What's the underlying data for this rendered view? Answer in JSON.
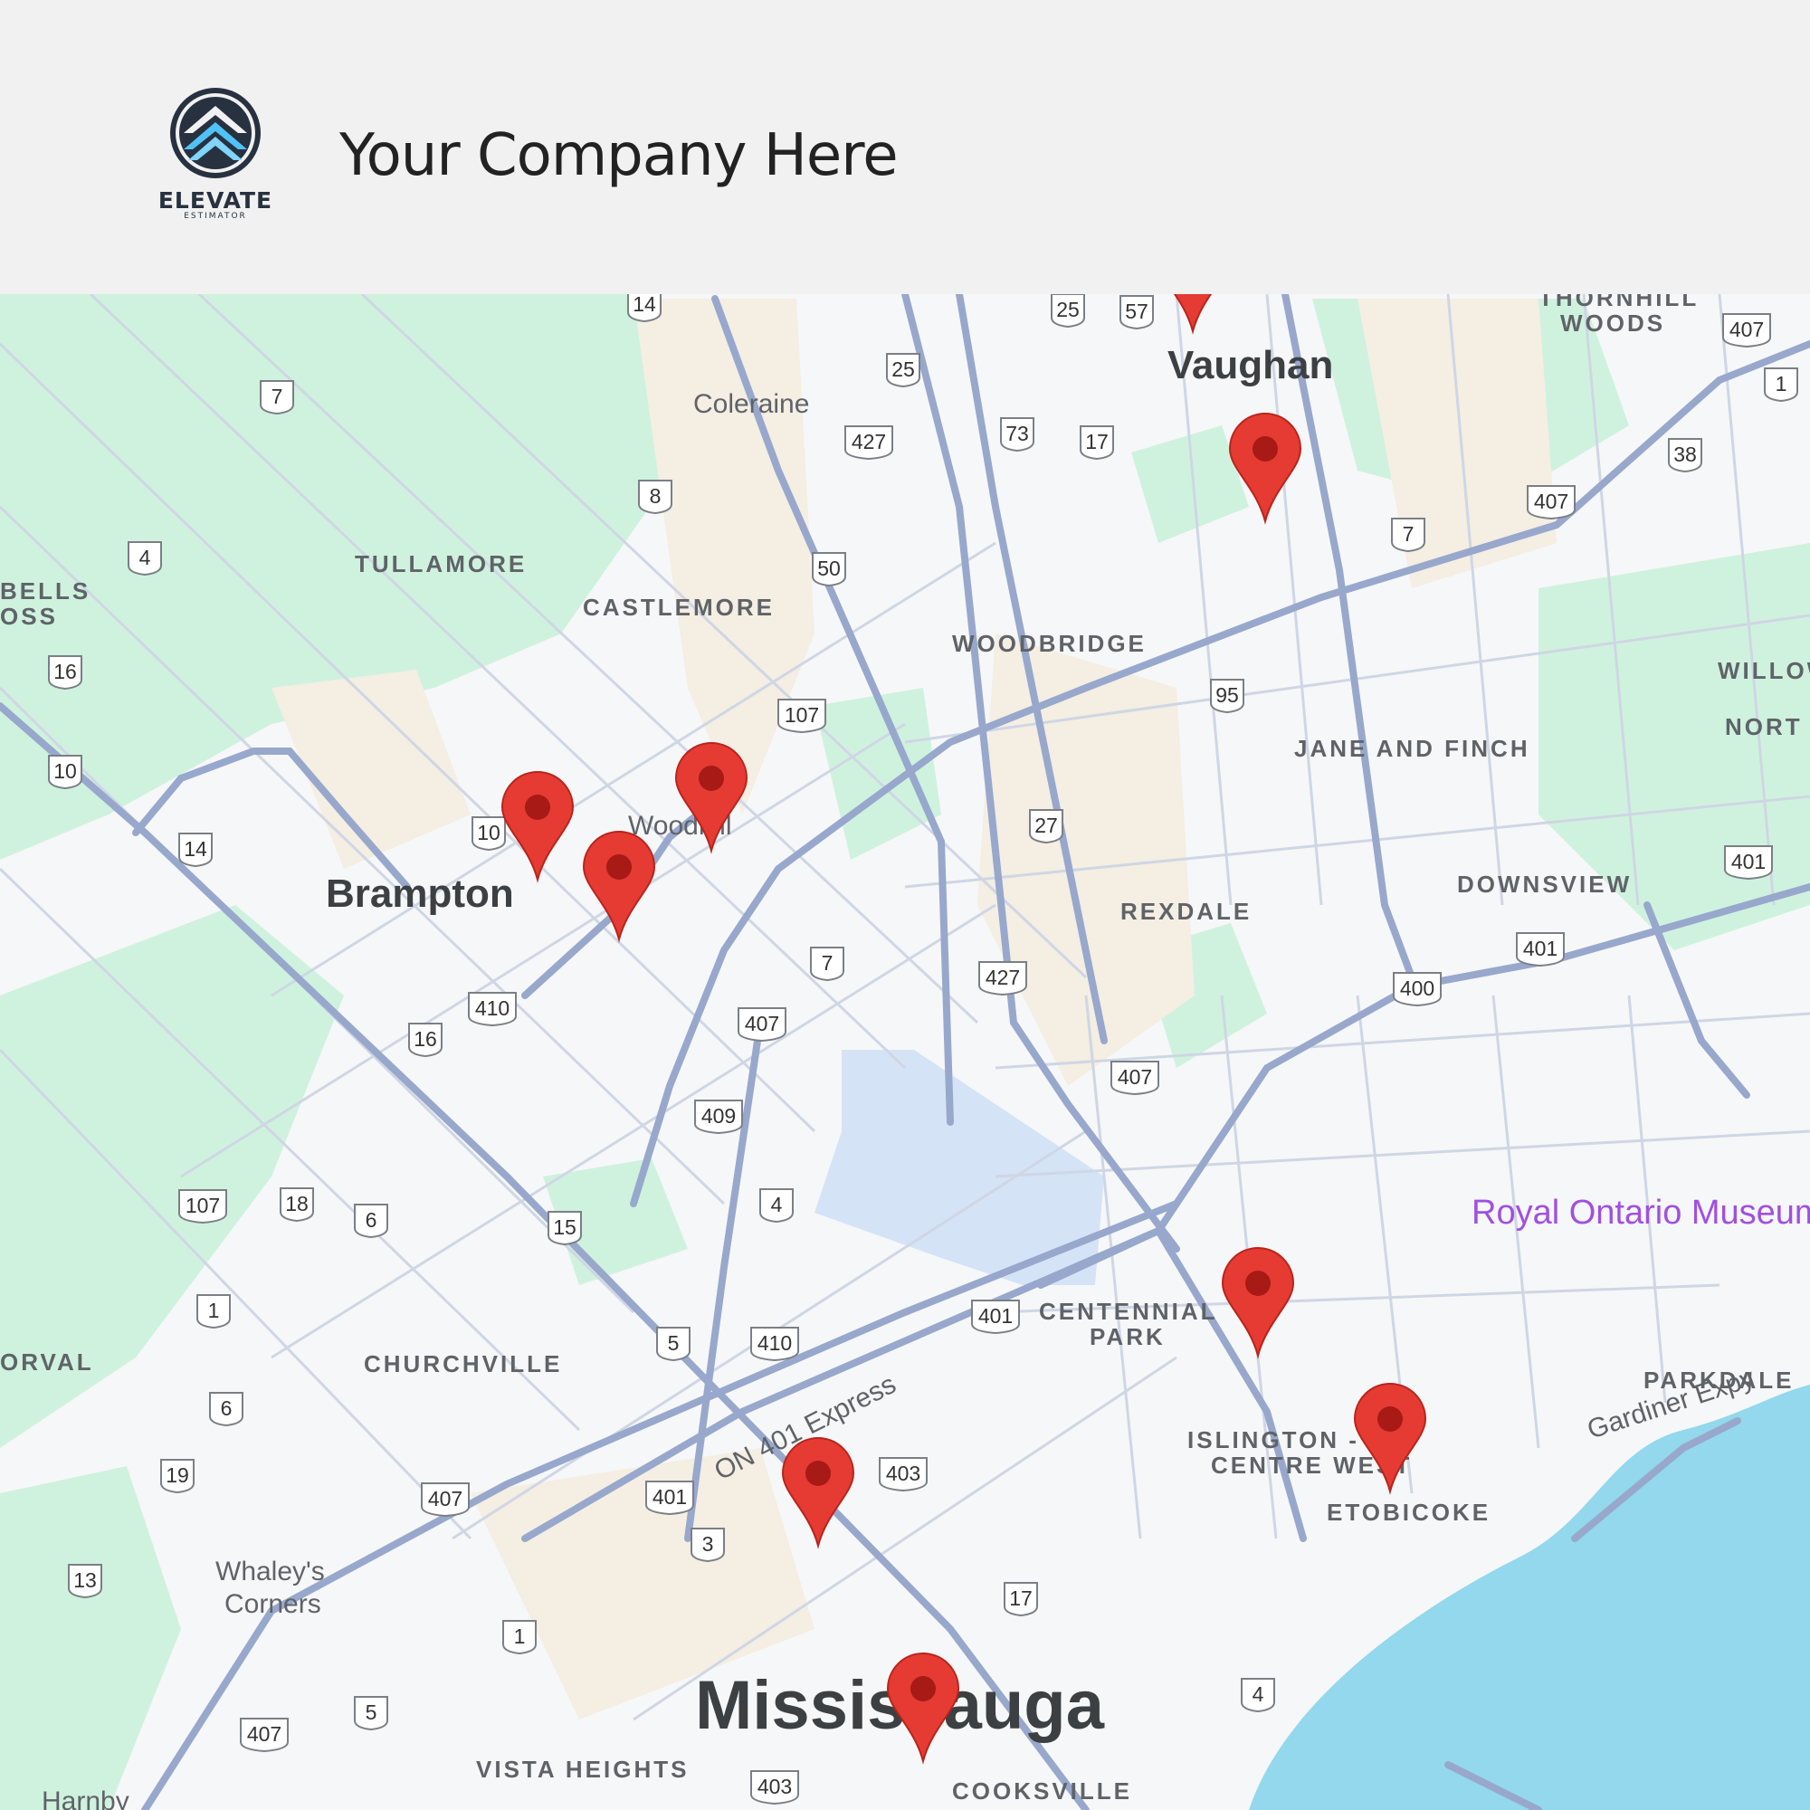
{
  "header": {
    "logo": {
      "word": "ELEVATE",
      "sub": "ESTIMATOR"
    },
    "company_name": "Your Company Here"
  },
  "map": {
    "colors": {
      "land": "#f7f7f7",
      "park": "#cdf1dd",
      "water": "#93d8ec",
      "lake": "#d4e2f6",
      "urban": "#f3ede2",
      "road": "#9aa8c8",
      "minor_road": "#c6cedf",
      "pin": "#e53b32",
      "pin_dot": "#a71a15"
    },
    "city_labels": [
      "Vaughan",
      "Brampton",
      "Woodhill",
      "Coleraine",
      "Mississauga",
      "Whaley's",
      "Corners",
      "Harnby"
    ],
    "area_labels": [
      "TULLAMORE",
      "CASTLEMORE",
      "WOODBRIDGE",
      "JANE AND FINCH",
      "DOWNSVIEW",
      "REXDALE",
      "CENTENNIAL",
      "PARK",
      "CHURCHVILLE",
      "ISLINGTON -",
      "CENTRE WEST",
      "ETOBICOKE",
      "PARKDALE",
      "VISTA HEIGHTS",
      "COOKSVILLE",
      "THORNHILL",
      "WOODS",
      "NORT",
      "WILLOW",
      "BELLS",
      "OSS",
      "ORVAL"
    ],
    "poi": "Royal Ontario Museum",
    "road_labels": [
      "ON 401 Express",
      "Gardiner Expy"
    ],
    "highway_shields": [
      "14",
      "25",
      "57",
      "407",
      "1",
      "25",
      "7",
      "427",
      "73",
      "17",
      "38",
      "407",
      "7",
      "8",
      "4",
      "50",
      "16",
      "107",
      "95",
      "10",
      "14",
      "10",
      "27",
      "401",
      "7",
      "427",
      "401",
      "400",
      "410",
      "16",
      "407",
      "409",
      "407",
      "107",
      "18",
      "6",
      "15",
      "4",
      "1",
      "5",
      "410",
      "401",
      "6",
      "19",
      "407",
      "401",
      "403",
      "3",
      "13",
      "1",
      "17",
      "5",
      "407",
      "403",
      "4"
    ],
    "pins": [
      "pin-1",
      "pin-2",
      "pin-3",
      "pin-4",
      "pin-5",
      "pin-6",
      "pin-7",
      "pin-8",
      "pin-9"
    ]
  }
}
